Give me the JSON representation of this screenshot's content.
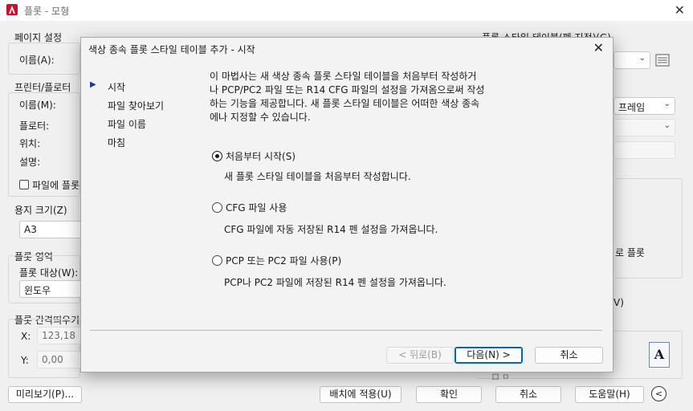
{
  "main_window": {
    "title": "플롯 - 모형",
    "page_setup": {
      "group_label": "페이지 설정",
      "name_label": "이름(A):"
    },
    "plot_style_table_label": "플롯 스타일 테이블(펜 지정)(G)",
    "printer": {
      "group_label": "프린터/플로터",
      "name_label": "이름(M):",
      "plotter_label": "플로터:",
      "location_label": "위치:",
      "description_label": "설명:",
      "plot_to_file_label": "파일에 플롯"
    },
    "shade_option_value": "프레임",
    "paper_size": {
      "group_label": "용지 크기(Z)",
      "value": "A3"
    },
    "plot_area": {
      "group_label": "플롯 영역",
      "what_to_plot_label": "플롯 대상(W):",
      "value": "윈도우"
    },
    "plot_offset": {
      "group_label": "플롯 간격띄우기",
      "x_label": "X:",
      "x_value": "123,18",
      "y_label": "Y:",
      "y_value": "0,00"
    },
    "right_fragments": {
      "text1": "로 플롯",
      "text2": "V)",
      "text3": "ロ  ㅁ"
    },
    "buttons": {
      "preview": "미리보기(P)...",
      "apply_to_layout": "배치에 적용(U)",
      "ok": "확인",
      "cancel": "취소",
      "help": "도움말(H)",
      "expand": "<"
    },
    "a_icon_letter": "A"
  },
  "wizard": {
    "title": "색상 종속 플롯 스타일 테이블 추가 - 시작",
    "steps": [
      "시작",
      "파일 찾아보기",
      "파일 이름",
      "마침"
    ],
    "current_step": "시작",
    "intro_lines": [
      "이 마법사는 새 색상 종속 플롯 스타일 테이블을 처음부터 작성하거",
      "나  PCP/PC2 파일 또는 R14 CFG 파일의 설정을 가져옴으로써 작성",
      "하는 기능을 제공합니다. 새 플롯 스타일 테이블은 어떠한 색상 종속",
      "에나 지정할 수 있습니다."
    ],
    "options": [
      {
        "label": "처음부터 시작(S)",
        "description": "새 플롯 스타일 테이블을 처음부터 작성합니다.",
        "selected": true
      },
      {
        "label": "CFG 파일 사용",
        "description": "CFG 파일에 자동 저장된 R14 펜 설정을 가져옵니다.",
        "selected": false
      },
      {
        "label": "PCP 또는 PC2 파일 사용(P)",
        "description": "PCP나 PC2 파일에 저장된 R14 펜 설정을 가져옵니다.",
        "selected": false
      }
    ],
    "buttons": {
      "back": "< 뒤로(B)",
      "next": "다음(N) >",
      "cancel": "취소"
    }
  },
  "colors": {
    "accent": "#0067c0",
    "app_icon_red": "#c8102e",
    "step_arrow": "#1e3a8a"
  }
}
